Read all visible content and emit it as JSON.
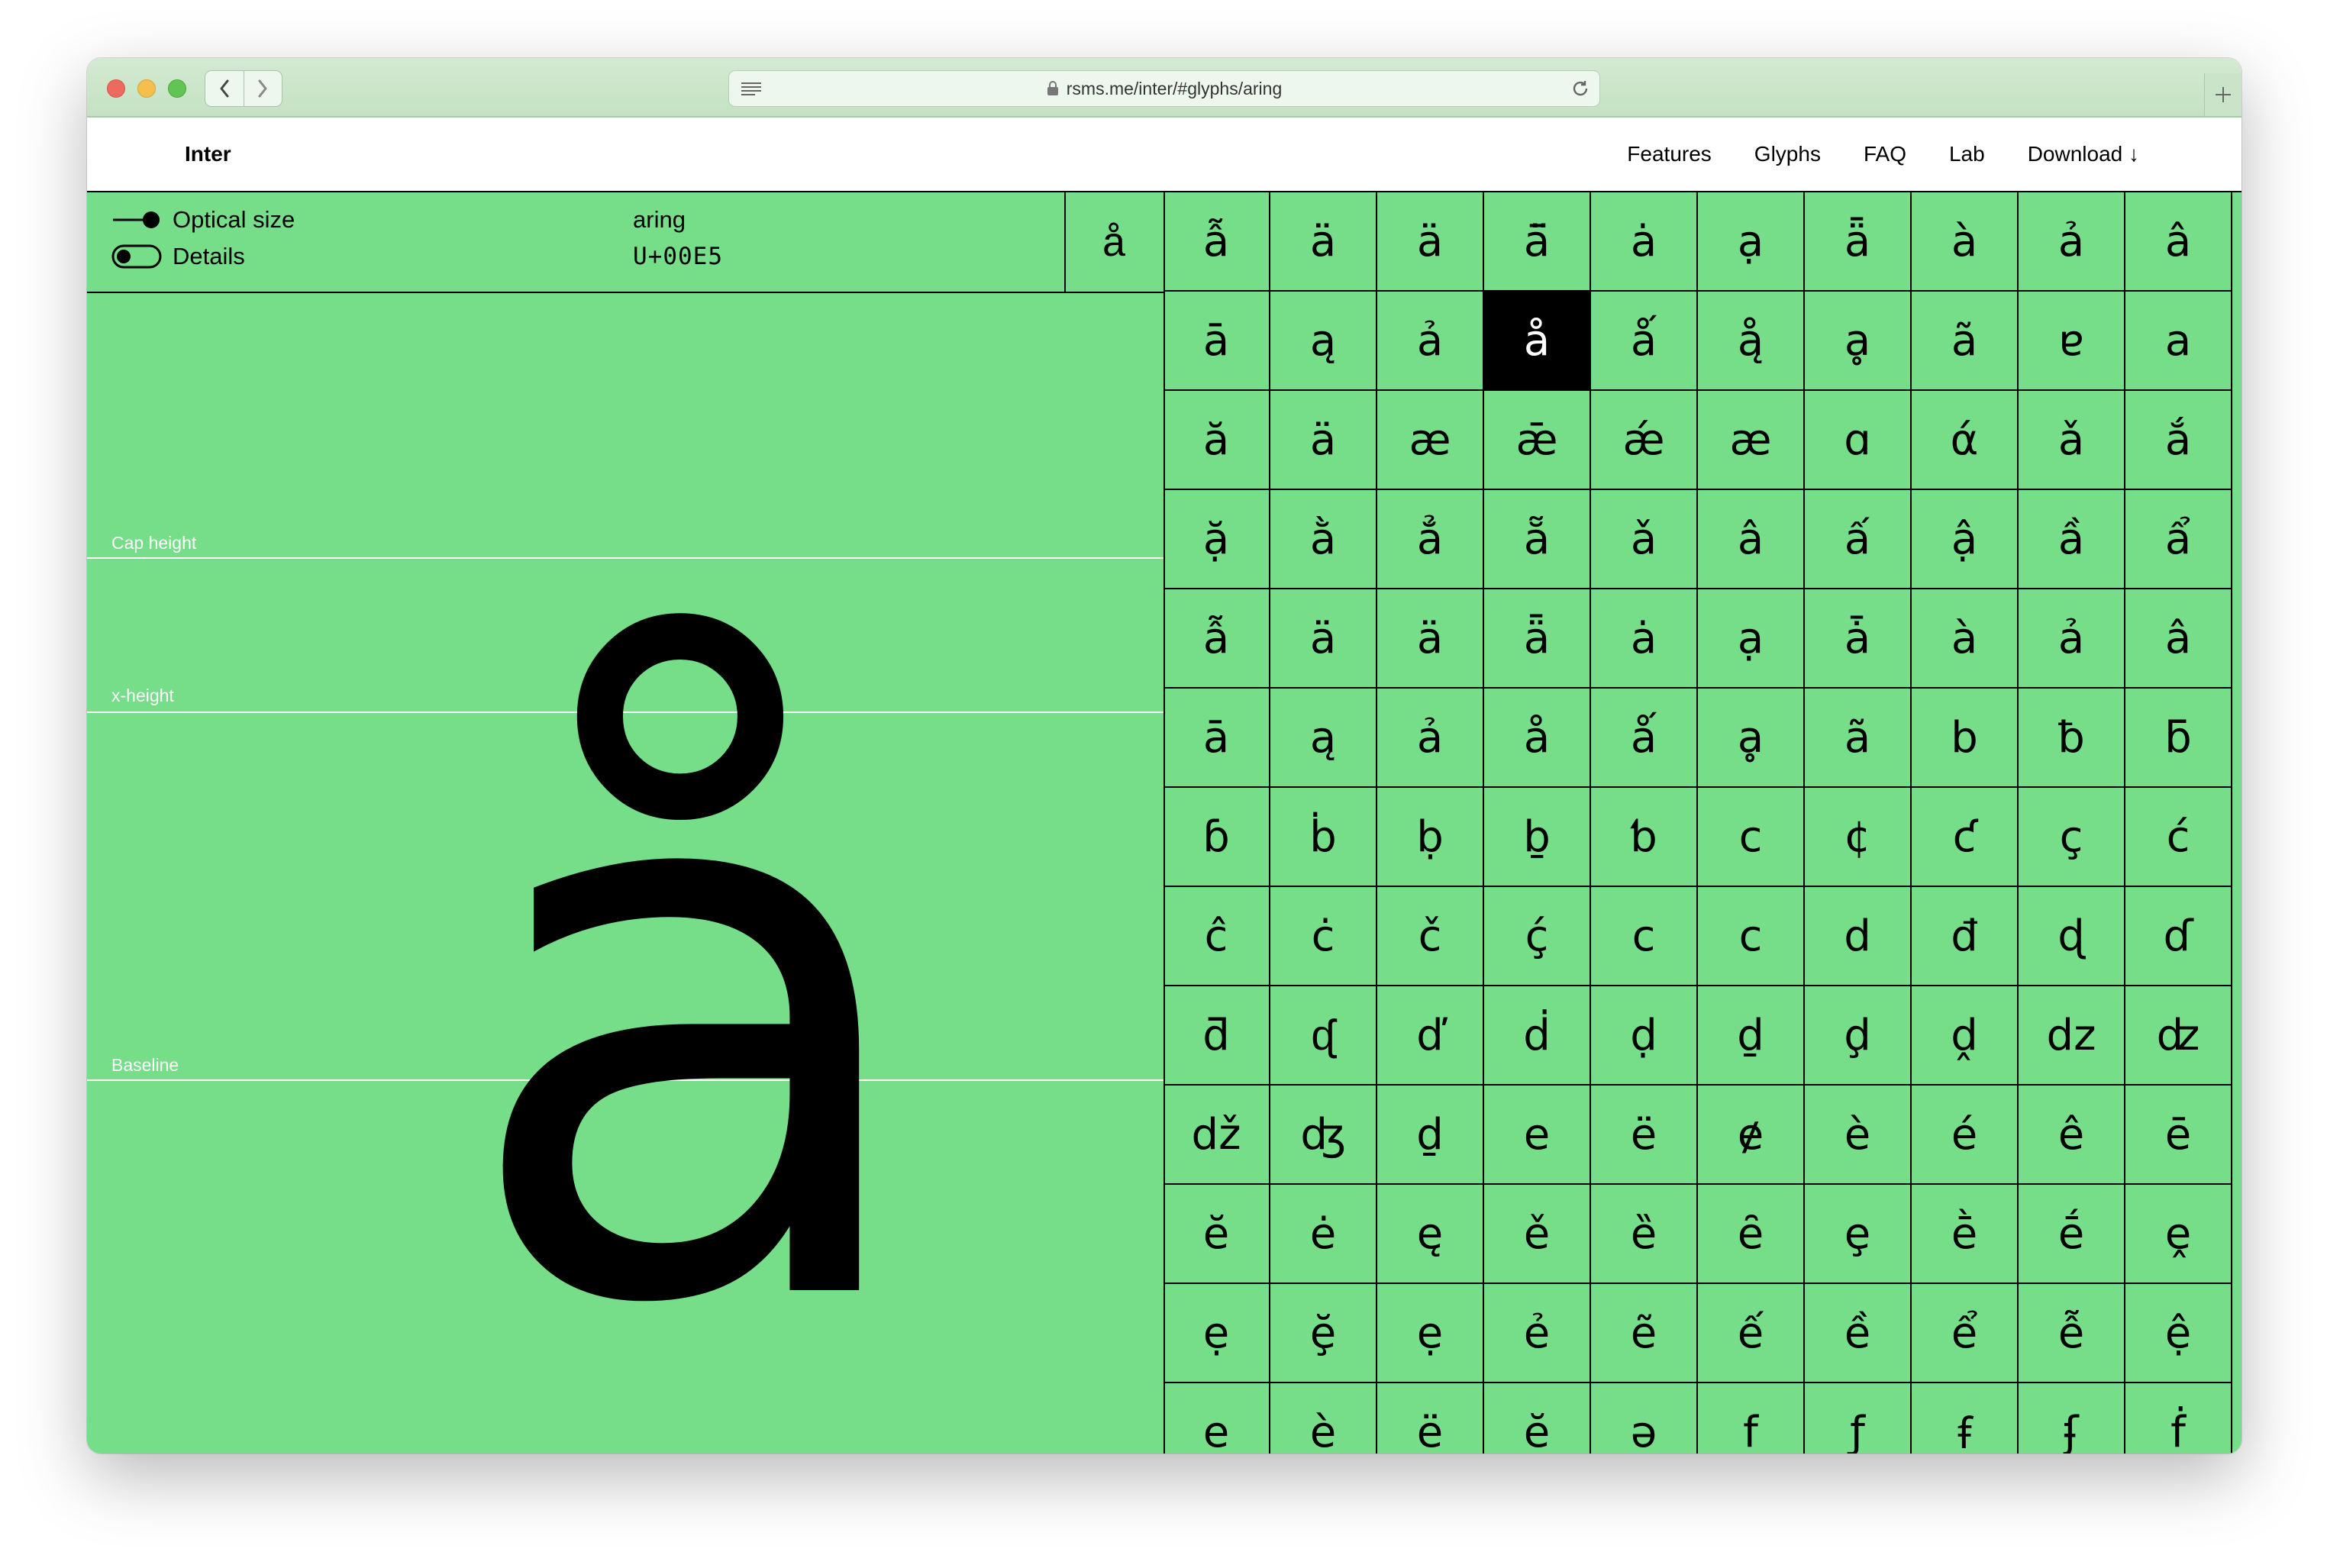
{
  "browser": {
    "url": "rsms.me/inter/#glyphs/aring"
  },
  "site": {
    "logo": "Inter",
    "menu": [
      "Features",
      "Glyphs",
      "FAQ",
      "Lab",
      "Download ↓"
    ]
  },
  "controls": {
    "optical_size_label": "Optical size",
    "details_label": "Details"
  },
  "glyph": {
    "name": "aring",
    "codepoint": "U+00E5",
    "char": "å"
  },
  "metrics": {
    "cap_height": "Cap height",
    "x_height": "x-height",
    "baseline": "Baseline"
  },
  "selected_index": 13,
  "grid": [
    "ẫ",
    "ä",
    "ä",
    "ā̈",
    "ȧ",
    "ạ",
    "ǟ",
    "à",
    "ả",
    "â",
    "ā",
    "ą",
    "ả",
    "å",
    "ǻ",
    "ą̊",
    "ḁ",
    "ã",
    "ɐ",
    "a",
    "ă",
    "ä",
    "æ",
    "ǣ",
    "ǽ",
    "æ",
    "ɑ",
    "ά",
    "ǎ",
    "ắ",
    "ặ",
    "ằ",
    "ẳ",
    "ẵ",
    "ǎ",
    "â",
    "ấ",
    "ậ",
    "ầ",
    "ẩ",
    "ẫ",
    "ä",
    "ä",
    "ǟ",
    "ȧ",
    "ạ",
    "ǡ",
    "à",
    "ả",
    "â",
    "ā",
    "ą",
    "ả",
    "å",
    "ǻ",
    "ḁ",
    "ã",
    "b",
    "ƀ",
    "ƃ",
    "ɓ",
    "ḃ",
    "ḅ",
    "ḇ",
    "ƅ",
    "c",
    "¢",
    "ƈ",
    "ç",
    "ć",
    "ĉ",
    "ċ",
    "č",
    "ḉ",
    "c",
    "c",
    "d",
    "đ",
    "ɖ",
    "ɗ",
    "ƌ",
    "ᶑ",
    "ď",
    "ḋ",
    "ḍ",
    "ḏ",
    "ḑ",
    "ḓ",
    "dz",
    "ʣ",
    "dž",
    "ʤ",
    "ḏ",
    "e",
    "ë",
    "ɇ",
    "è",
    "é",
    "ê",
    "ē",
    "ĕ",
    "ė",
    "ę",
    "ě",
    "ȅ",
    "ȇ",
    "ȩ",
    "ḕ",
    "ḗ",
    "ḙ",
    "ẹ",
    "ḝ",
    "ẹ",
    "ẻ",
    "ẽ",
    "ế",
    "ề",
    "ể",
    "ễ",
    "ệ",
    "e",
    "è",
    "ë",
    "ĕ",
    "ə",
    "f",
    "ƒ",
    "ꞙ",
    "ʄ",
    "ḟ"
  ]
}
